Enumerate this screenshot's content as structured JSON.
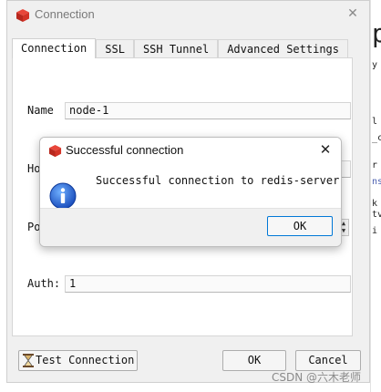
{
  "window": {
    "title": "Connection",
    "close_glyph": "✕",
    "icon": "redis-cube-icon"
  },
  "tabs": [
    {
      "label": "Connection",
      "active": true
    },
    {
      "label": "SSL",
      "active": false
    },
    {
      "label": "SSH Tunnel",
      "active": false
    },
    {
      "label": "Advanced Settings",
      "active": false
    }
  ],
  "form": {
    "name_label": "Name",
    "name_value": "node-1",
    "host_label": "Ho",
    "port_label": "Po",
    "auth_label": "Auth:",
    "auth_value": "1"
  },
  "buttons": {
    "test_connection": "Test Connection",
    "ok": "OK",
    "cancel": "Cancel"
  },
  "dialog": {
    "title": "Successful connection",
    "message": "Successful connection to redis-server",
    "ok": "OK",
    "close_glyph": "✕",
    "icon": "info-icon"
  },
  "background": {
    "lines": [
      "p",
      "y",
      "l",
      "_c",
      "r",
      "ns",
      "k",
      "tv",
      "i"
    ]
  },
  "watermark": "CSDN @六木老师",
  "colors": {
    "redis_red": "#d82c20",
    "info_blue": "#1a62c9",
    "focus_blue": "#0078d7"
  }
}
